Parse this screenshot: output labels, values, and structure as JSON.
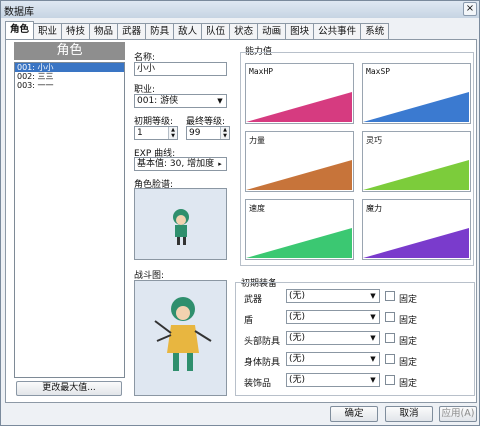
{
  "window": {
    "title": "数据库",
    "close_glyph": "×"
  },
  "tabs": [
    "角色",
    "职业",
    "特技",
    "物品",
    "武器",
    "防具",
    "敌人",
    "队伍",
    "状态",
    "动画",
    "图块",
    "公共事件",
    "系统"
  ],
  "actors": {
    "header": "角色",
    "items": [
      "001: 小小",
      "002: 三三",
      "003: 一一"
    ],
    "change_max_button": "更改最大值..."
  },
  "form": {
    "name_label": "名称:",
    "name_value": "小小",
    "class_label": "职业:",
    "class_value": "001: 游侠",
    "initial_level_label": "初期等级:",
    "initial_level_value": "1",
    "final_level_label": "最终等级:",
    "final_level_value": "99",
    "exp_label": "EXP 曲线:",
    "exp_value": "基本值: 30, 增加度",
    "face_label": "角色脸谱:",
    "battler_label": "战斗图:"
  },
  "abilities": {
    "label": "能力值",
    "graphs": [
      {
        "name": "MaxHP",
        "color": "#d63b80"
      },
      {
        "name": "MaxSP",
        "color": "#3b7ad0"
      },
      {
        "name": "力量",
        "color": "#c7743a"
      },
      {
        "name": "灵巧",
        "color": "#7ccc3b"
      },
      {
        "name": "速度",
        "color": "#3bc872"
      },
      {
        "name": "魔力",
        "color": "#7a3bcc"
      }
    ]
  },
  "equipment": {
    "label": "初期装备",
    "fixed_label": "固定",
    "rows": [
      {
        "slot": "武器",
        "value": "(无)"
      },
      {
        "slot": "盾",
        "value": "(无)"
      },
      {
        "slot": "头部防具",
        "value": "(无)"
      },
      {
        "slot": "身体防具",
        "value": "(无)"
      },
      {
        "slot": "装饰品",
        "value": "(无)"
      }
    ]
  },
  "buttons": {
    "ok": "确定",
    "cancel": "取消",
    "apply": "应用(A)"
  }
}
